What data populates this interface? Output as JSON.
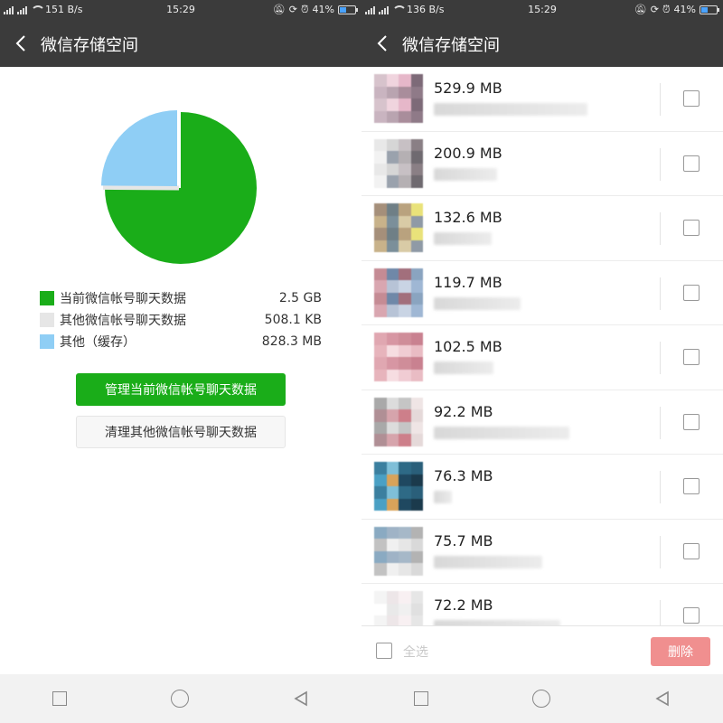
{
  "colors": {
    "accent": "#1aad19",
    "current_account": "#1aad19",
    "other_account": "#e6e6e6",
    "cache": "#8fcef5",
    "header": "#3b3b3b",
    "delete_disabled": "#f08f8f"
  },
  "left": {
    "status_bar": {
      "net_speed": "151 B/s",
      "time": "15:29",
      "battery": "41%"
    },
    "title": "微信存储空间",
    "chart_data": {
      "type": "pie",
      "slices": [
        {
          "label": "当前微信帐号聊天数据",
          "value": 2.5,
          "unit": "GB",
          "color": "#1aad19"
        },
        {
          "label": "其他微信帐号聊天数据",
          "value": 0.000508,
          "unit": "GB",
          "color": "#e6e6e6"
        },
        {
          "label": "其他（缓存）",
          "value": 0.828,
          "unit": "GB",
          "color": "#8fcef5"
        }
      ]
    },
    "legend": [
      {
        "label": "当前微信帐号聊天数据",
        "value": "2.5 GB",
        "color": "#1aad19"
      },
      {
        "label": "其他微信帐号聊天数据",
        "value": "508.1 KB",
        "color": "#e6e6e6"
      },
      {
        "label": "其他（缓存）",
        "value": "828.3 MB",
        "color": "#8fcef5"
      }
    ],
    "buttons": {
      "manage": "管理当前微信帐号聊天数据",
      "clean": "清理其他微信帐号聊天数据"
    }
  },
  "right": {
    "status_bar": {
      "net_speed": "136 B/s",
      "time": "15:29",
      "battery": "41%"
    },
    "title": "微信存储空间",
    "items": [
      {
        "size": "529.9 MB"
      },
      {
        "size": "200.9 MB"
      },
      {
        "size": "132.6 MB"
      },
      {
        "size": "119.7 MB"
      },
      {
        "size": "102.5 MB"
      },
      {
        "size": "92.2 MB"
      },
      {
        "size": "76.3 MB"
      },
      {
        "size": "75.7 MB"
      },
      {
        "size": "72.2 MB"
      }
    ],
    "select_all": "全选",
    "delete": "删除"
  },
  "icons": [
    "signal-icon",
    "wifi-icon",
    "mute-icon",
    "lock-rotate-icon",
    "alarm-icon",
    "battery-icon",
    "back-icon",
    "checkbox-icon",
    "nav-recent-icon",
    "nav-home-icon",
    "nav-back-icon"
  ]
}
